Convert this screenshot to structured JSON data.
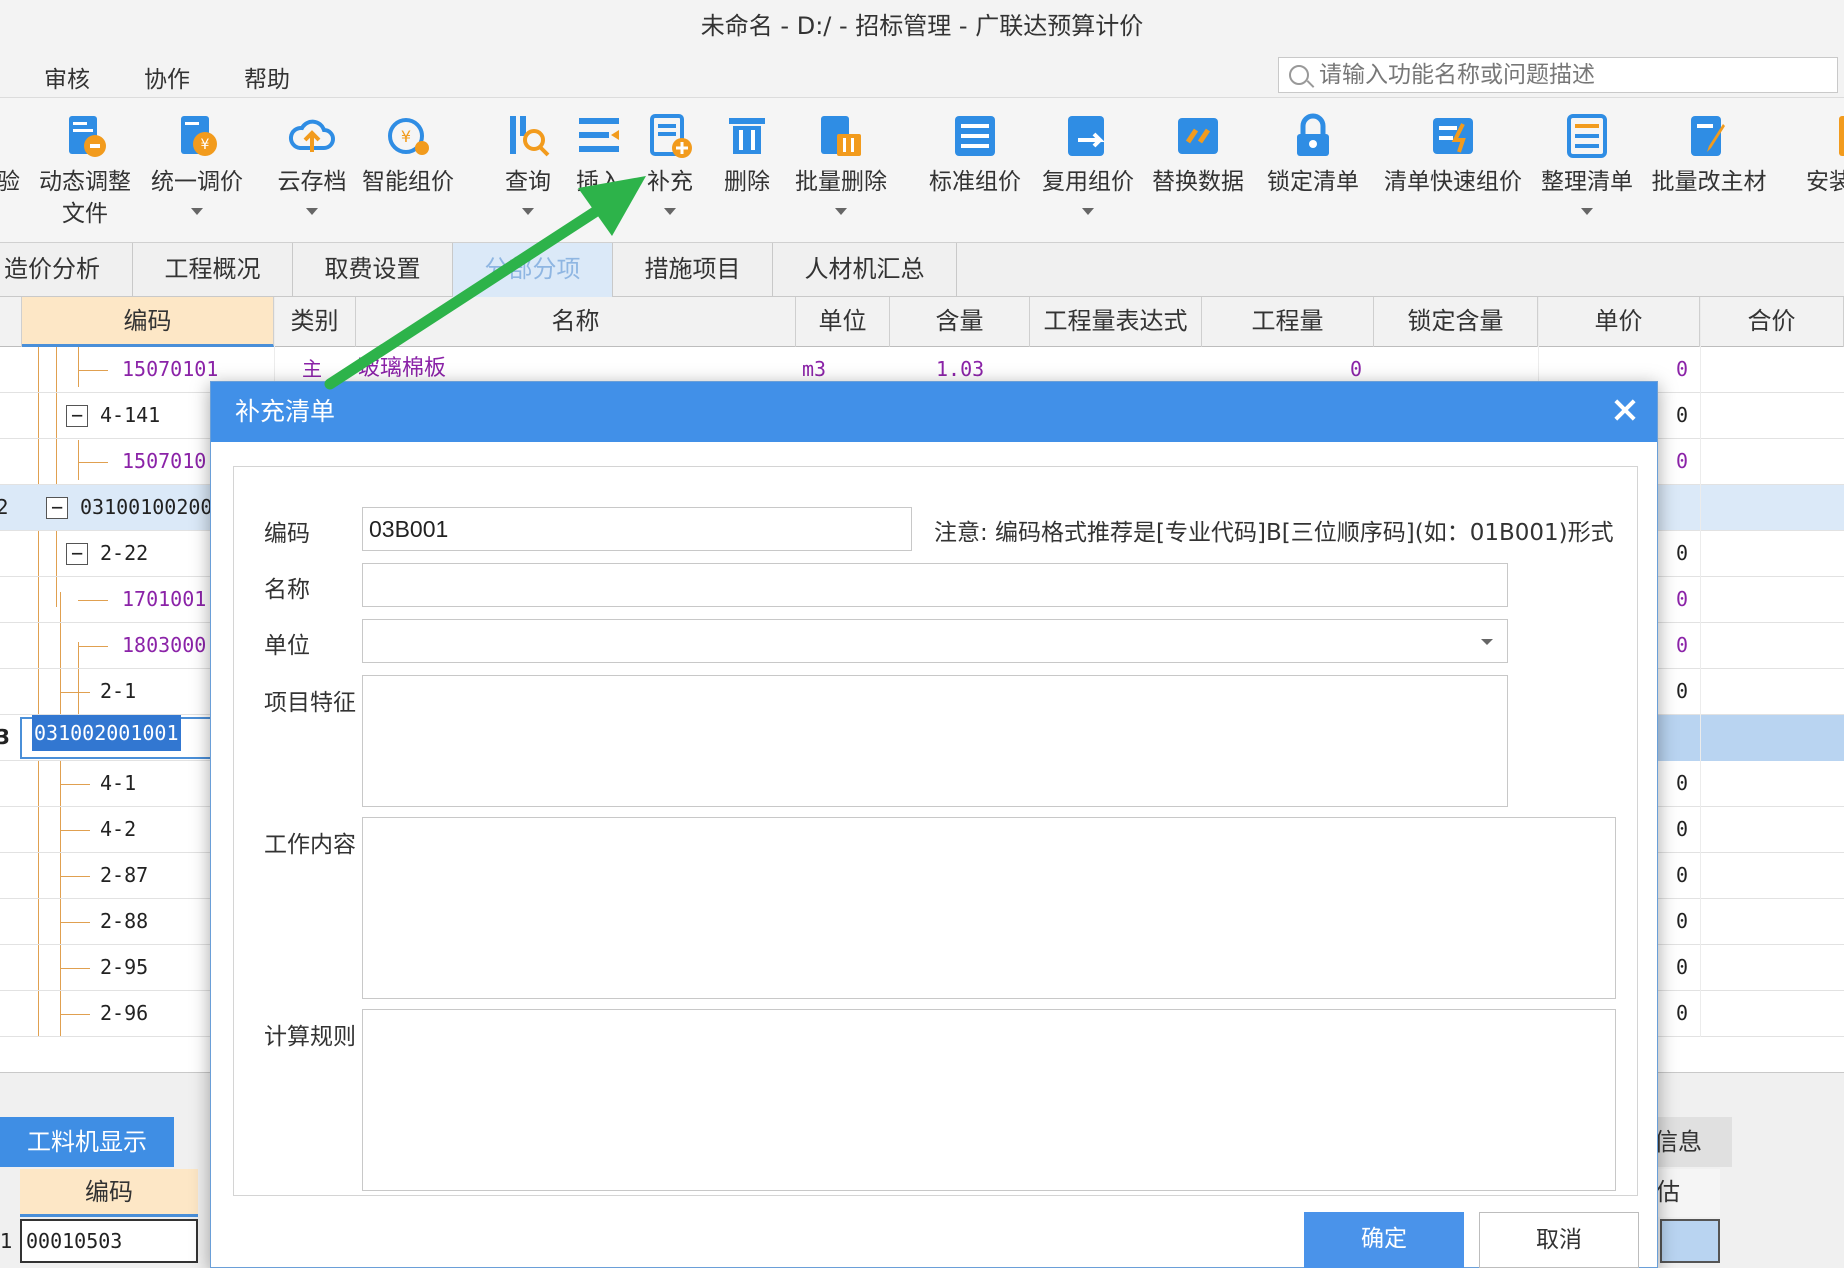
{
  "window": {
    "title": "未命名 - D:/ - 招标管理 - 广联达预算计价"
  },
  "menu": {
    "items": [
      "审核",
      "协作",
      "帮助"
    ],
    "search_placeholder": "请输入功能名称或问题描述"
  },
  "toolbar": {
    "buttons": [
      {
        "label": "验",
        "icon": "doc-icon"
      },
      {
        "label": "动态调整",
        "label2": "文件",
        "icon": "dynamic-adjust-icon"
      },
      {
        "label": "统一调价",
        "icon": "unify-price-icon"
      },
      {
        "label": "云存档",
        "icon": "cloud-upload-icon"
      },
      {
        "label": "智能组价",
        "icon": "smart-price-icon"
      },
      {
        "label": "查询",
        "icon": "query-icon"
      },
      {
        "label": "插入",
        "icon": "insert-icon"
      },
      {
        "label": "补充",
        "icon": "supplement-icon"
      },
      {
        "label": "删除",
        "icon": "trash-icon"
      },
      {
        "label": "批量删除",
        "icon": "batch-delete-icon"
      },
      {
        "label": "标准组价",
        "icon": "standard-price-icon"
      },
      {
        "label": "复用组价",
        "icon": "reuse-price-icon"
      },
      {
        "label": "替换数据",
        "icon": "replace-data-icon"
      },
      {
        "label": "锁定清单",
        "icon": "lock-icon"
      },
      {
        "label": "清单快速组价",
        "icon": "quick-price-icon"
      },
      {
        "label": "整理清单",
        "icon": "organize-list-icon"
      },
      {
        "label": "批量改主材",
        "icon": "batch-edit-icon"
      },
      {
        "label": "安装",
        "icon": "install-icon"
      }
    ],
    "accent": "#2f8de4"
  },
  "tabs": [
    "造价分析",
    "工程概况",
    "取费设置",
    "分部分项",
    "措施项目",
    "人材机汇总"
  ],
  "grid": {
    "columns": [
      "编码",
      "类别",
      "名称",
      "单位",
      "含量",
      "工程量表达式",
      "工程量",
      "锁定含量",
      "单价",
      "合价"
    ],
    "rows": [
      {
        "code": "15070101",
        "type": "主",
        "name": "玻璃棉板",
        "unit": "m3",
        "qty": "1.03",
        "amount": "0",
        "price": "0"
      },
      {
        "code": "4-141",
        "price": "0"
      },
      {
        "code": "1507010",
        "price": "0"
      },
      {
        "code": "03100100200"
      },
      {
        "code": "2-22",
        "price": "0"
      },
      {
        "code": "1701001",
        "price": "0"
      },
      {
        "code": "1803000",
        "price": "0"
      },
      {
        "code": "2-1",
        "price": "0"
      },
      {
        "code": "031002001001"
      },
      {
        "code": "4-1",
        "price": "0"
      },
      {
        "code": "4-2",
        "price": "0"
      },
      {
        "code": "2-87",
        "price": "0"
      },
      {
        "code": "2-88",
        "price": "0"
      },
      {
        "code": "2-95",
        "price": "0"
      },
      {
        "code": "2-96",
        "price": "0"
      }
    ],
    "row_numbers": [
      "2",
      "3"
    ]
  },
  "bottom_panel": {
    "tab_left": "工料机显示",
    "tab_right": "信息",
    "header_left": "编码",
    "header_right": "估",
    "cell_value": "00010503",
    "row_marker": "1"
  },
  "dialog": {
    "title": "补充清单",
    "labels": {
      "code": "编码",
      "name": "名称",
      "unit": "单位",
      "feature": "项目特征",
      "work": "工作内容",
      "rule": "计算规则"
    },
    "code_value": "03B001",
    "code_note": "注意: 编码格式推荐是[专业代码]B[三位顺序码](如：01B001)形式",
    "ok": "确定",
    "cancel": "取消"
  }
}
